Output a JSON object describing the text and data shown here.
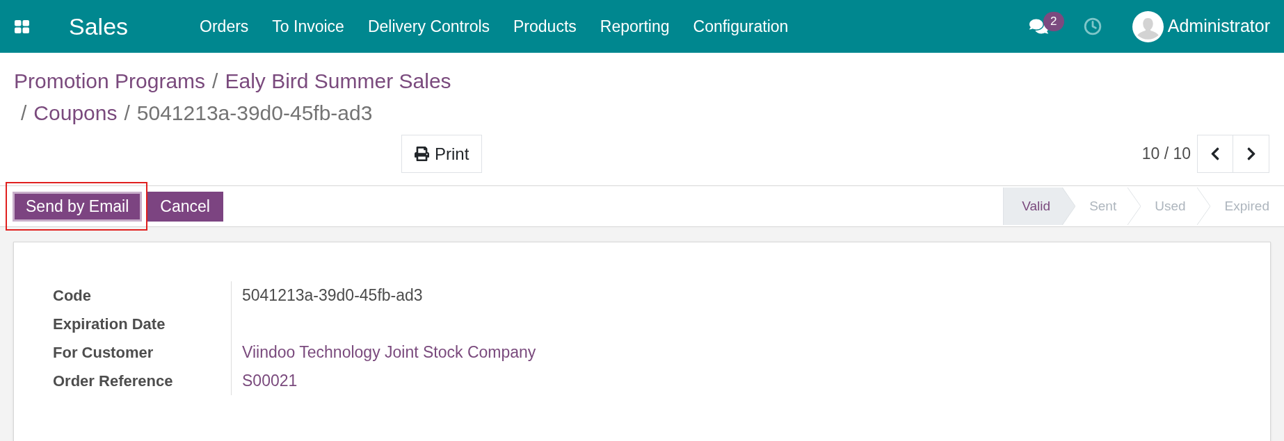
{
  "navbar": {
    "app_name": "Sales",
    "menu": [
      "Orders",
      "To Invoice",
      "Delivery Controls",
      "Products",
      "Reporting",
      "Configuration"
    ],
    "messages_badge": "2",
    "user": "Administrator"
  },
  "breadcrumbs": [
    {
      "label": "Promotion Programs",
      "active": false
    },
    {
      "separator": "/",
      "label": "Ealy Bird Summer Sales",
      "active": false
    },
    {
      "separator": "/",
      "label": "Coupons",
      "active": false
    },
    {
      "separator": "/",
      "label": "5041213a-39d0-45fb-ad3",
      "active": true
    }
  ],
  "actions": {
    "print": "Print"
  },
  "pager": {
    "counter": "10 / 10"
  },
  "status_bar": {
    "buttons": [
      {
        "label": "Send by Email",
        "highlighted": true
      },
      {
        "label": "Cancel",
        "highlighted": false
      }
    ],
    "steps": [
      {
        "label": "Valid",
        "selected": true
      },
      {
        "label": "Sent",
        "selected": false
      },
      {
        "label": "Used",
        "selected": false
      },
      {
        "label": "Expired",
        "selected": false
      }
    ]
  },
  "form": {
    "fields": [
      {
        "label": "Code",
        "value": "5041213a-39d0-45fb-ad3",
        "kind": "text"
      },
      {
        "label": "Expiration Date"
      },
      {
        "label": "For Customer",
        "value": "Viindoo Technology Joint Stock Company",
        "kind": "link"
      },
      {
        "label": "Order Reference",
        "value": "S00021",
        "kind": "link"
      }
    ]
  }
}
